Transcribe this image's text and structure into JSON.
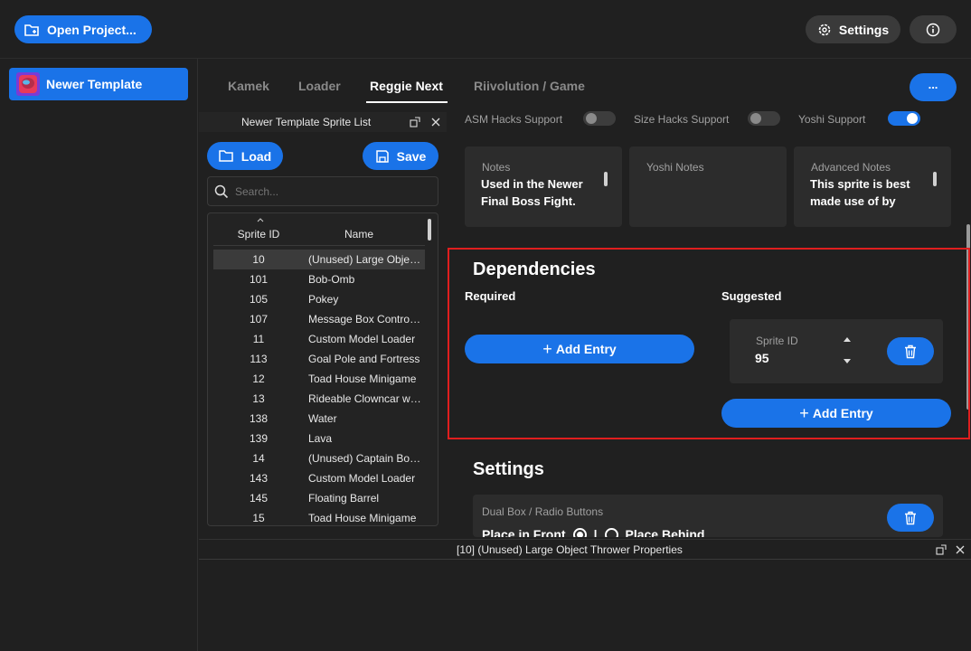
{
  "topbar": {
    "open_project_label": "Open Project...",
    "settings_label": "Settings"
  },
  "sidebar": {
    "project_name": "Newer Template"
  },
  "tabs": [
    {
      "label": "Kamek"
    },
    {
      "label": "Loader"
    },
    {
      "label": "Reggie Next"
    },
    {
      "label": "Riivolution / Game"
    }
  ],
  "more_label": "...",
  "sprite_list": {
    "title": "Newer Template Sprite List",
    "load_label": "Load",
    "save_label": "Save",
    "search_placeholder": "Search...",
    "col_id": "Sprite ID",
    "col_name": "Name",
    "rows": [
      {
        "id": "10",
        "name": "(Unused) Large Object Thrower"
      },
      {
        "id": "101",
        "name": "Bob-Omb"
      },
      {
        "id": "105",
        "name": "Pokey"
      },
      {
        "id": "107",
        "name": "Message Box Controller"
      },
      {
        "id": "11",
        "name": "Custom Model Loader"
      },
      {
        "id": "113",
        "name": "Goal Pole and Fortress"
      },
      {
        "id": "12",
        "name": "Toad House Minigame"
      },
      {
        "id": "13",
        "name": "Rideable Clowncar with"
      },
      {
        "id": "138",
        "name": "Water"
      },
      {
        "id": "139",
        "name": "Lava"
      },
      {
        "id": "14",
        "name": "(Unused) Captain Bowser"
      },
      {
        "id": "143",
        "name": "Custom Model Loader"
      },
      {
        "id": "145",
        "name": "Floating Barrel"
      },
      {
        "id": "15",
        "name": "Toad House Minigame"
      }
    ]
  },
  "support": {
    "asm": {
      "label": "ASM Hacks Support",
      "on": false
    },
    "size": {
      "label": "Size Hacks Support",
      "on": false
    },
    "yoshi": {
      "label": "Yoshi Support",
      "on": true
    }
  },
  "notes": {
    "notes_title": "Notes",
    "notes_body": "Used in the Newer Final Boss Fight.",
    "yoshi_title": "Yoshi Notes",
    "yoshi_body": "",
    "advanced_title": "Advanced Notes",
    "advanced_body": "This sprite is best made use of by"
  },
  "dependencies": {
    "title": "Dependencies",
    "required_label": "Required",
    "suggested_label": "Suggested",
    "add_entry_label": "Add Entry",
    "sprite_id_label": "Sprite ID",
    "sprite_id_value": "95"
  },
  "settings_section": {
    "title": "Settings",
    "setting_label": "Dual Box / Radio Buttons",
    "option_front": "Place in Front",
    "separator": "|",
    "option_behind": "Place Behind"
  },
  "properties": {
    "title": "[10] (Unused) Large Object Thrower Properties"
  },
  "colors": {
    "accent": "#1a73e8",
    "highlight_border": "#e01e1e",
    "background": "#202020",
    "card": "#2c2c2c"
  }
}
